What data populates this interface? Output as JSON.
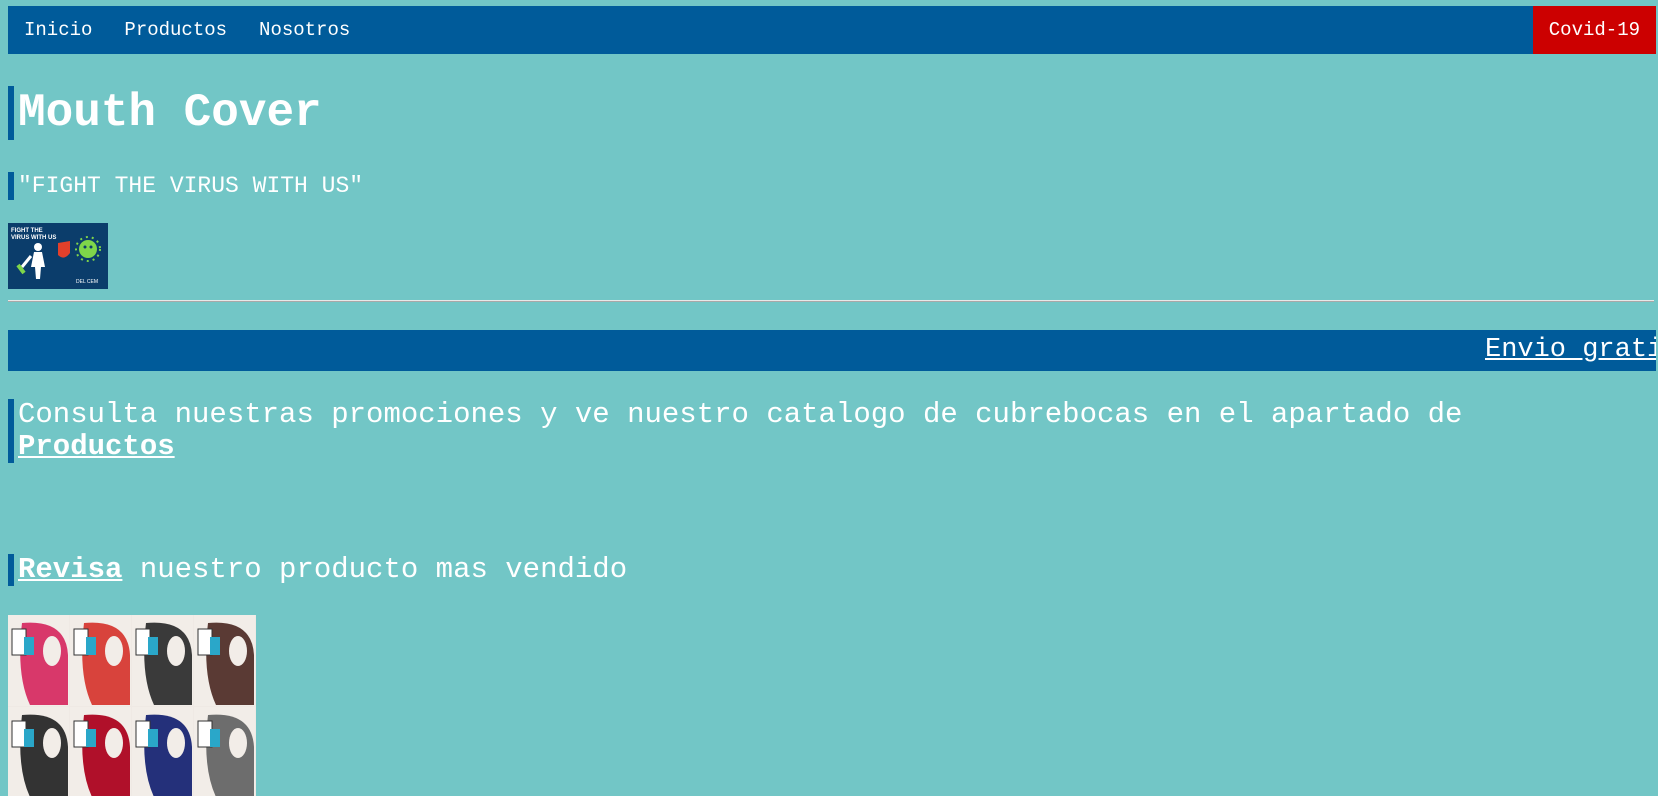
{
  "nav": {
    "items": [
      "Inicio",
      "Productos",
      "Nosotros"
    ],
    "covid_label": "Covid-19"
  },
  "header": {
    "title": "Mouth Cover",
    "tagline": "\"FIGHT THE VIRUS WITH US\""
  },
  "banner_image": {
    "line1": "FIGHT THE",
    "line2": "VIRUS WITH US",
    "footer": "DEL CEM"
  },
  "marquee": {
    "text": "Envio gratis"
  },
  "promo": {
    "text": "Consulta nuestras promociones y ve nuestro catalogo de cubrebocas en el apartado de ",
    "link": "Productos"
  },
  "bestseller": {
    "link": "Revisa",
    "text": " nuestro producto mas vendido"
  },
  "colors": {
    "background": "#72c6c6",
    "nav": "#005b9a",
    "covid": "#cc0000"
  },
  "masks": {
    "top_row": [
      "#d8386a",
      "#d8433c",
      "#3a3a3a",
      "#5a3a34"
    ],
    "bottom_row": [
      "#333333",
      "#b0102a",
      "#24307a",
      "#6d6d6d"
    ]
  }
}
